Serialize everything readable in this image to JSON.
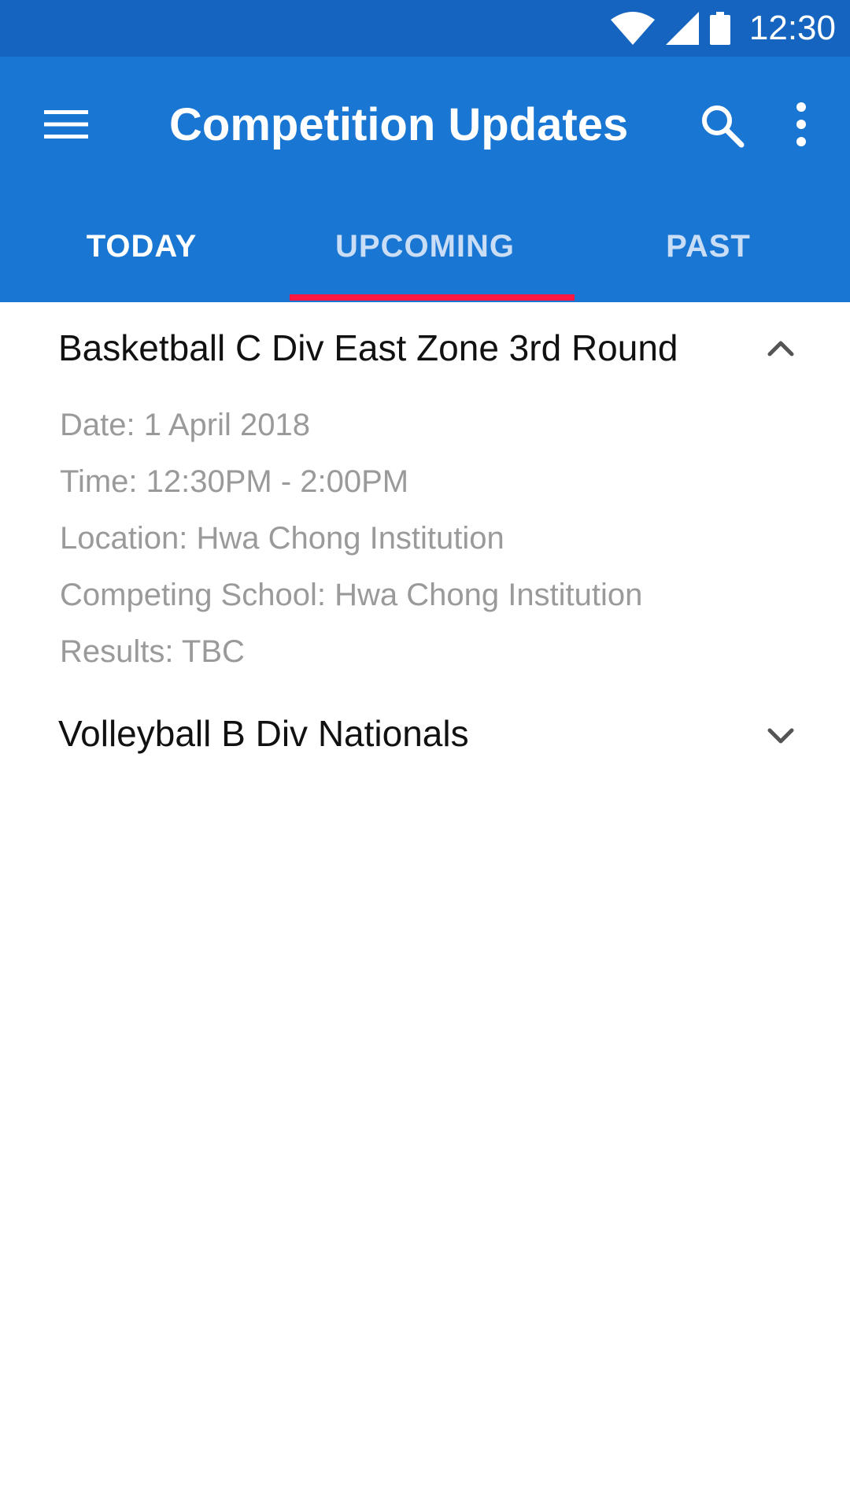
{
  "status_bar": {
    "time": "12:30",
    "icons": [
      "wifi-icon",
      "signal-icon",
      "battery-icon"
    ]
  },
  "app_bar": {
    "title": "Competition Updates",
    "menu_icon": "menu-icon",
    "search_icon": "search-icon",
    "more_icon": "more-vert-icon"
  },
  "tabs": [
    {
      "label": "TODAY"
    },
    {
      "label": "UPCOMING",
      "selected": true
    },
    {
      "label": "PAST"
    }
  ],
  "colors": {
    "status_bar": "#1565c0",
    "app_bar": "#1976d2",
    "tab_indicator": "#ff1744",
    "detail_text": "#9a9a9a"
  },
  "competitions": [
    {
      "title": "Basketball C Div East Zone 3rd Round",
      "expanded": true,
      "details": [
        "Date: 1 April 2018",
        "Time: 12:30PM - 2:00PM",
        "Location: Hwa Chong Institution",
        "Competing School: Hwa Chong Institution",
        "Results: TBC"
      ]
    },
    {
      "title": "Volleyball B Div Nationals",
      "expanded": false
    }
  ]
}
